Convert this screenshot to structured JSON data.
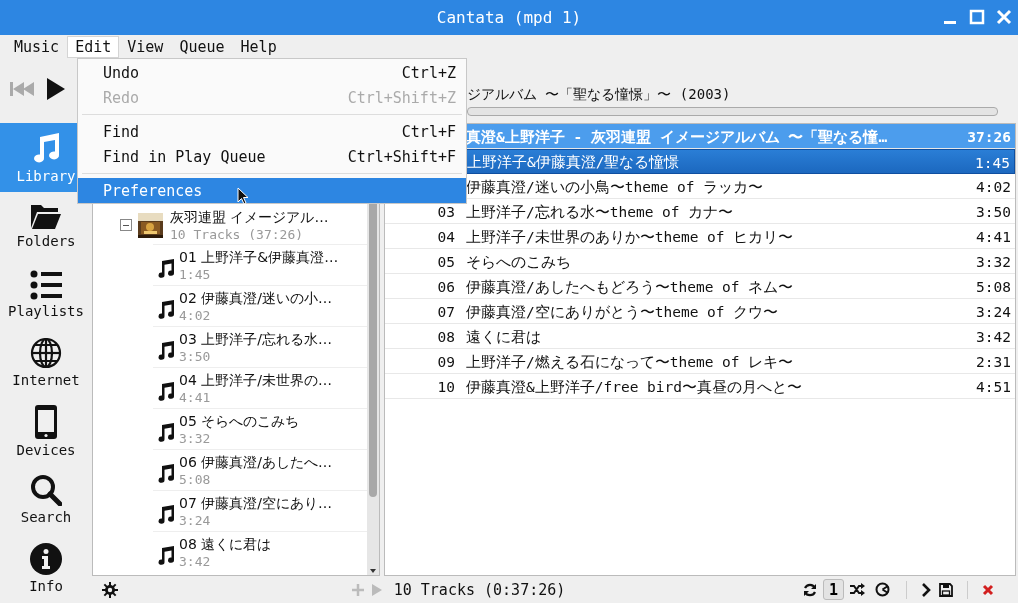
{
  "window": {
    "title": "Cantata (mpd 1)"
  },
  "menubar": [
    {
      "label": "Music",
      "selected": false
    },
    {
      "label": "Edit",
      "selected": true
    },
    {
      "label": "View",
      "selected": false
    },
    {
      "label": "Queue",
      "selected": false
    },
    {
      "label": "Help",
      "selected": false
    }
  ],
  "menu": [
    {
      "kind": "item",
      "label": "Undo",
      "shortcut": "Ctrl+Z",
      "disabled": false,
      "selected": false
    },
    {
      "kind": "item",
      "label": "Redo",
      "shortcut": "Ctrl+Shift+Z",
      "disabled": true,
      "selected": false
    },
    {
      "kind": "separator"
    },
    {
      "kind": "item",
      "label": "Find",
      "shortcut": "Ctrl+F",
      "disabled": false,
      "selected": false
    },
    {
      "kind": "item",
      "label": "Find in Play Queue",
      "shortcut": "Ctrl+Shift+F",
      "disabled": false,
      "selected": false
    },
    {
      "kind": "separator"
    },
    {
      "kind": "item",
      "label": "Preferences",
      "disabled": false,
      "selected": true
    }
  ],
  "toolbar": {
    "buttons": [
      {
        "kind": "previous",
        "disabled": true
      },
      {
        "kind": "play",
        "disabled": false
      }
    ],
    "now_playing": "ジアルバム 〜「聖なる憧憬」〜 (2003)",
    "progress": {
      "level": 0
    }
  },
  "sidebar": {
    "items": [
      {
        "kind": "library",
        "label": "Library",
        "selected": true
      },
      {
        "kind": "folders",
        "label": "Folders",
        "selected": false
      },
      {
        "kind": "playlists",
        "label": "Playlists",
        "selected": false
      },
      {
        "kind": "internet",
        "label": "Internet",
        "selected": false
      },
      {
        "kind": "devices",
        "label": "Devices",
        "selected": false
      },
      {
        "kind": "search",
        "label": "Search",
        "selected": false
      },
      {
        "kind": "info",
        "label": "Info",
        "selected": false
      }
    ]
  },
  "library": {
    "album": {
      "title": "灰羽連盟 イメージアル…",
      "subtitle": "10 Tracks (37:26)",
      "expanded": true,
      "children": [
        {
          "title": "01 上野洋子&伊藤真澄…",
          "time": "1:45"
        },
        {
          "title": "02 伊藤真澄/迷いの小…",
          "time": "4:02"
        },
        {
          "title": "03 上野洋子/忘れる水…",
          "time": "3:50"
        },
        {
          "title": "04 上野洋子/未世界の…",
          "time": "4:41"
        },
        {
          "title": "05 そらへのこみち",
          "time": "3:32"
        },
        {
          "title": "06 伊藤真澄/あしたへ…",
          "time": "5:08"
        },
        {
          "title": "07 伊藤真澄/空にあり…",
          "time": "3:24"
        },
        {
          "title": "08 遠くに君は",
          "time": "3:42"
        }
      ]
    }
  },
  "queue": {
    "rows": [
      {
        "kind": "header",
        "title": "真澄&上野洋子 - 灰羽連盟 イメージアルバム 〜「聖なる憧…",
        "time": "37:26",
        "selected": true
      },
      {
        "kind": "track",
        "title": "上野洋子&伊藤真澄/聖なる憧憬",
        "time": "1:45",
        "selected": true
      },
      {
        "kind": "track",
        "title": "伊藤真澄/迷いの小鳥〜theme of ラッカ〜",
        "time": "4:02",
        "selected": false
      },
      {
        "kind": "track",
        "number": "03",
        "title": "上野洋子/忘れる水〜theme of カナ〜",
        "time": "3:50",
        "selected": false
      },
      {
        "kind": "track",
        "number": "04",
        "title": "上野洋子/未世界のありか〜theme of ヒカリ〜",
        "time": "4:41",
        "selected": false
      },
      {
        "kind": "track",
        "number": "05",
        "title": "そらへのこみち",
        "time": "3:32",
        "selected": false
      },
      {
        "kind": "track",
        "number": "06",
        "title": "伊藤真澄/あしたへもどろう〜theme of ネム〜",
        "time": "5:08",
        "selected": false
      },
      {
        "kind": "track",
        "number": "07",
        "title": "伊藤真澄/空にありがとう〜theme of クウ〜",
        "time": "3:24",
        "selected": false
      },
      {
        "kind": "track",
        "number": "08",
        "title": "遠くに君は",
        "time": "3:42",
        "selected": false
      },
      {
        "kind": "track",
        "number": "09",
        "title": "上野洋子/燃える石になって〜theme of レキ〜",
        "time": "2:31",
        "selected": false
      },
      {
        "kind": "track",
        "number": "10",
        "title": "伊藤真澄&上野洋子/free bird〜真昼の月へと〜",
        "time": "4:51",
        "selected": false
      }
    ]
  },
  "status_bar": {
    "summary": "10 Tracks (0:37:26)",
    "toggles": [
      {
        "kind": "repeat",
        "on": false
      },
      {
        "kind": "single",
        "label": "1",
        "on": true
      },
      {
        "kind": "shuffle",
        "on": false
      },
      {
        "kind": "consume",
        "on": false
      }
    ]
  }
}
